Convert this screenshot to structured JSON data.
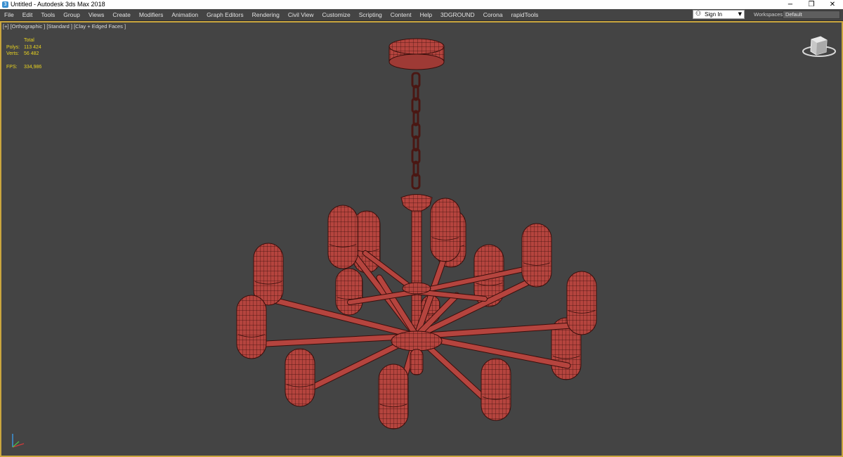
{
  "window": {
    "title": "Untitled - Autodesk 3ds Max 2018",
    "controls": {
      "minimize": "−",
      "restore": "❐",
      "close": "✕"
    }
  },
  "menu": {
    "items": [
      "File",
      "Edit",
      "Tools",
      "Group",
      "Views",
      "Create",
      "Modifiers",
      "Animation",
      "Graph Editors",
      "Rendering",
      "Civil View",
      "Customize",
      "Scripting",
      "Content",
      "Help",
      "3DGROUND",
      "Corona",
      "rapidTools"
    ]
  },
  "account": {
    "sign_in": "Sign In"
  },
  "workspace": {
    "label": "Workspaces:",
    "value": "Default"
  },
  "viewport": {
    "label": "[+] [Orthographic ] [Standard ] [Clay + Edged Faces ]",
    "stats": {
      "header": "Total",
      "polys_label": "Polys:",
      "polys_value": "113 424",
      "verts_label": "Verts:",
      "verts_value": "56 482",
      "fps_label": "FPS:",
      "fps_value": "334,986"
    }
  },
  "colors": {
    "viewport_bg": "#444444",
    "active_border": "#caa63e",
    "model": "#b5443e",
    "wire": "#3a0f0c",
    "stats_text": "#e8d21f"
  },
  "icons": {
    "view_cube": "view-cube-icon",
    "axis_tripod": "axis-tripod-icon"
  }
}
